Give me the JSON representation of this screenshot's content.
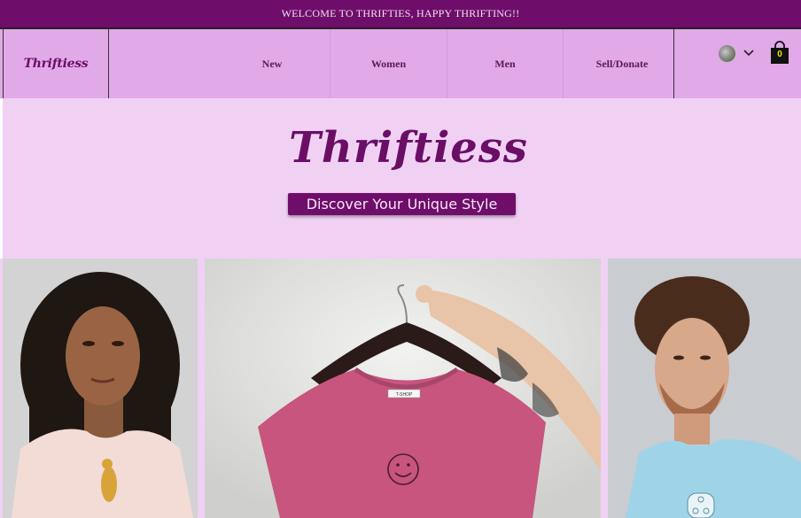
{
  "announcement": "WELCOME TO THRIFTIES, HAPPY THRIFTING!!",
  "header": {
    "brand": "Thriftiess",
    "nav": [
      {
        "label": "New"
      },
      {
        "label": "Women"
      },
      {
        "label": "Men"
      },
      {
        "label": "Sell/Donate"
      }
    ],
    "cart_count": "0"
  },
  "hero": {
    "title": "Thriftiess",
    "cta": "Discover Your Unique Style"
  },
  "products": {
    "shirt_tag": "T-SHOP"
  },
  "colors": {
    "announcement_bg": "#6f0e6a",
    "header_bg": "#e2a9e8",
    "hero_bg": "#f0d1f4",
    "brand_purple": "#6a0e66"
  },
  "icons": [
    "user-avatar",
    "chevron-down-icon",
    "shopping-bag-icon"
  ]
}
